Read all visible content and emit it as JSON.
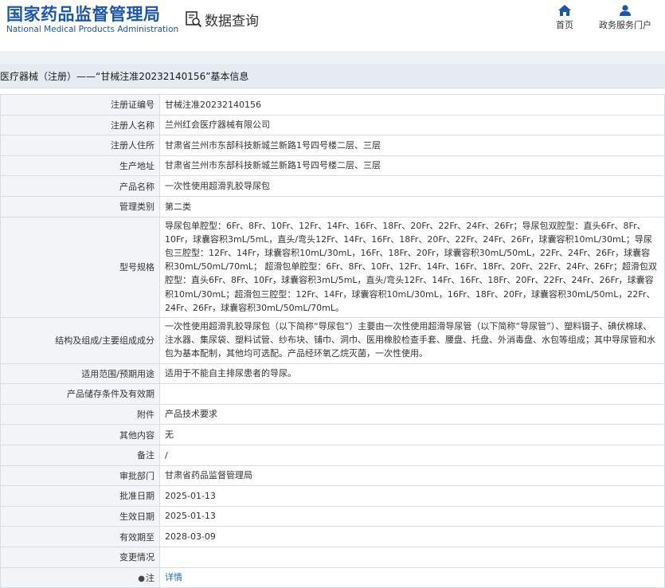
{
  "header": {
    "logo_cn": "国家药品监督管理局",
    "logo_en": "National Medical Products Administration",
    "query_label": "数据查询",
    "nav": {
      "home": "首页",
      "service": "政务服务门户"
    }
  },
  "page_title": "医疗器械（注册）——“甘械注准20232140156”基本信息",
  "rows": [
    {
      "label": "注册证编号",
      "value": "甘械注准20232140156"
    },
    {
      "label": "注册人名称",
      "value": "兰州红会医疗器械有限公司"
    },
    {
      "label": "注册人住所",
      "value": "甘肃省兰州市东部科技新城兰新路1号四号楼二层、三层"
    },
    {
      "label": "生产地址",
      "value": "甘肃省兰州市东部科技新城兰新路1号四号楼二层、三层"
    },
    {
      "label": "产品名称",
      "value": "一次性使用超滑乳胶导尿包"
    },
    {
      "label": "管理类别",
      "value": "第二类"
    },
    {
      "label": "型号规格",
      "value": "导尿包单腔型：6Fr、8Fr、10Fr、12Fr、14Fr、16Fr、18Fr、20Fr、22Fr、24Fr、26Fr；导尿包双腔型：直头6Fr、8Fr、10Fr，球囊容积3mL/5mL，直头/弯头12Fr、14Fr、16Fr、18Fr、20Fr、22Fr、24Fr、26Fr，球囊容积10mL/30mL；导尿包三腔型：12Fr、14Fr，球囊容积10mL/30mL，16Fr、18Fr、20Fr，球囊容积30mL/50mL，22Fr、24Fr、26Fr，球囊容积30mL/50mL/70mL； 超滑包单腔型：6Fr、8Fr、10Fr、12Fr、14Fr、16Fr、18Fr、20Fr、22Fr、24Fr、26Fr；超滑包双腔型：直头6Fr、8Fr、10Fr，球囊容积3mL/5mL，直头/弯头12Fr、14Fr、16Fr、18Fr、20Fr、22Fr、24Fr、26Fr，球囊容积10mL/30mL；超滑包三腔型：12Fr、14Fr，球囊容积10mL/30mL，16Fr、18Fr、20Fr，球囊容积30mL/50mL，22Fr、24Fr、26Fr，球囊容积30mL/50mL/70mL。"
    },
    {
      "label": "结构及组成/主要组成成分",
      "value": "一次性使用超滑乳胶导尿包（以下简称“导尿包”）主要由一次性使用超滑导尿管（以下简称“导尿管”）、塑料镊子、碘伏棉球、注水器、集尿袋、塑料试管、纱布块、铺巾、洞巾、医用橡胶检查手套、腰盘、托盘、外消毒盘、水包等组成；其中导尿管和水包为基本配制，其他均可选配。产品经环氧乙烷灭菌，一次性使用。"
    },
    {
      "label": "适用范围/预期用途",
      "value": "适用于不能自主排尿患者的导尿。"
    },
    {
      "label": "产品储存条件及有效期",
      "value": ""
    },
    {
      "label": "附件",
      "value": "产品技术要求"
    },
    {
      "label": "其他内容",
      "value": "无"
    },
    {
      "label": "备注",
      "value": "/"
    },
    {
      "label": "审批部门",
      "value": "甘肃省药品监督管理局"
    },
    {
      "label": "批准日期",
      "value": "2025-01-13"
    },
    {
      "label": "生效日期",
      "value": "2025-01-13"
    },
    {
      "label": "有效期至",
      "value": "2028-03-09"
    },
    {
      "label": "变更情况",
      "value": ""
    },
    {
      "label": "注",
      "label_icon": "pin-icon",
      "value": "详情"
    }
  ]
}
